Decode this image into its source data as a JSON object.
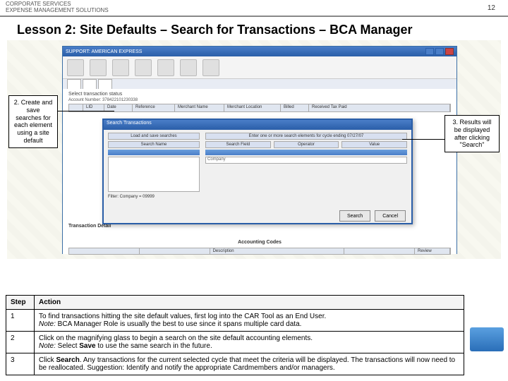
{
  "header": {
    "line1": "CORPORATE SERVICES",
    "line2": "EXPENSE MANAGEMENT SOLUTIONS",
    "page": "12"
  },
  "title": "Lesson 2:  Site Defaults – Search for Transactions – BCA Manager",
  "callout_left": "2. Create and save searches for each element using a site default",
  "callout_right": "3. Results will be displayed after clicking \"Search\"",
  "app": {
    "titlebar": "SUPPORT: AMERICAN EXPRESS",
    "body_header": "Select transaction status",
    "meta_row": "Account Number: 378422101230338",
    "meta_billed": "Billed",
    "meta_received": "Received",
    "grid_cols": [
      "",
      "LID",
      "Date",
      "Reference",
      "",
      "Merchant Name",
      "Merchant Location",
      "Billed",
      "Received Tax Paid"
    ],
    "popup": {
      "title": "Search Transactions",
      "left_hdr": "Load and save searches",
      "search_name": "Search Name",
      "right_hdr": "Enter one or more search elements for cycle ending 07/27/07",
      "cols": [
        "Search Field",
        "Operator",
        "Value"
      ],
      "field_sample": "Company",
      "left_footer": "Filter: Company = 09999",
      "btn_search": "Search",
      "btn_cancel": "Cancel"
    },
    "trans_detail": "Transaction Detail",
    "acct_codes": "Accounting Codes",
    "acct_cols": [
      "",
      "",
      "",
      "Description",
      "",
      ""
    ],
    "review_btn": "Review"
  },
  "table": {
    "head_step": "Step",
    "head_action": "Action",
    "rows": [
      {
        "step": "1",
        "line1": "To find transactions hitting the site default values, first log into the CAR Tool as an End User.",
        "note_label": "Note:",
        "note": " BCA Manager Role is usually the best to use since it spans multiple card data."
      },
      {
        "step": "2",
        "line1": "Click on the magnifying glass to begin a search on the site default accounting elements.",
        "note_label": "Note:",
        "note_pre": "  Select ",
        "save_word": "Save",
        "note_post": " to use the same search in the future."
      },
      {
        "step": "3",
        "pre": "Click ",
        "search_word": "Search",
        "post": ".  Any transactions for the current selected cycle that meet the criteria will be displayed.  The transactions will now need to be reallocated.  Suggestion: Identify and notify the appropriate Cardmembers and/or managers."
      }
    ]
  }
}
